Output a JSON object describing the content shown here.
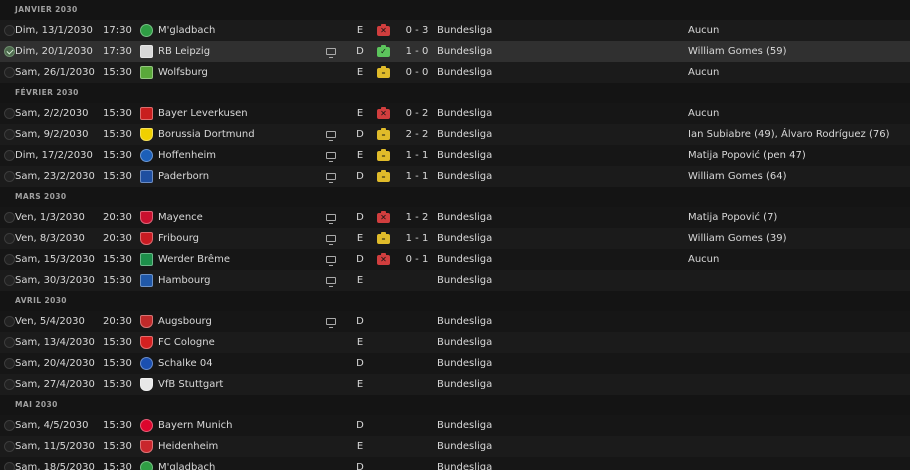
{
  "months": [
    {
      "label": "JANVIER 2030",
      "matches": [
        {
          "date": "Dim, 13/1/2030",
          "time": "17:30",
          "team": "M'gladbach",
          "crest": "mgladbach",
          "tv": false,
          "venue": "E",
          "result": "loss",
          "result_icon": "✕",
          "score": "0 - 3",
          "competition": "Bundesliga",
          "scorers": "Aucun",
          "selected": false
        },
        {
          "date": "Dim, 20/1/2030",
          "time": "17:30",
          "team": "RB Leipzig",
          "crest": "leipzig",
          "tv": true,
          "venue": "D",
          "result": "win",
          "result_icon": "✓",
          "score": "1 - 0",
          "competition": "Bundesliga",
          "scorers": "William Gomes (59)",
          "selected": true
        },
        {
          "date": "Sam, 26/1/2030",
          "time": "15:30",
          "team": "Wolfsburg",
          "crest": "wolfsburg",
          "tv": false,
          "venue": "E",
          "result": "draw",
          "result_icon": "–",
          "score": "0 - 0",
          "competition": "Bundesliga",
          "scorers": "Aucun",
          "selected": false
        }
      ]
    },
    {
      "label": "FÉVRIER 2030",
      "matches": [
        {
          "date": "Sam, 2/2/2030",
          "time": "15:30",
          "team": "Bayer Leverkusen",
          "crest": "leverkusen",
          "tv": false,
          "venue": "E",
          "result": "loss",
          "result_icon": "✕",
          "score": "0 - 2",
          "competition": "Bundesliga",
          "scorers": "Aucun",
          "selected": false
        },
        {
          "date": "Sam, 9/2/2030",
          "time": "15:30",
          "team": "Borussia Dortmund",
          "crest": "dortmund",
          "tv": true,
          "venue": "D",
          "result": "draw",
          "result_icon": "–",
          "score": "2 - 2",
          "competition": "Bundesliga",
          "scorers": "Ian Subiabre (49), Álvaro Rodríguez (76)",
          "selected": false
        },
        {
          "date": "Dim, 17/2/2030",
          "time": "15:30",
          "team": "Hoffenheim",
          "crest": "hoffenheim",
          "tv": true,
          "venue": "E",
          "result": "draw",
          "result_icon": "–",
          "score": "1 - 1",
          "competition": "Bundesliga",
          "scorers": "Matija Popović (pen 47)",
          "selected": false
        },
        {
          "date": "Sam, 23/2/2030",
          "time": "15:30",
          "team": "Paderborn",
          "crest": "paderborn",
          "tv": true,
          "venue": "D",
          "result": "draw",
          "result_icon": "–",
          "score": "1 - 1",
          "competition": "Bundesliga",
          "scorers": "William Gomes (64)",
          "selected": false
        }
      ]
    },
    {
      "label": "MARS 2030",
      "matches": [
        {
          "date": "Ven, 1/3/2030",
          "time": "20:30",
          "team": "Mayence",
          "crest": "mainz",
          "tv": true,
          "venue": "D",
          "result": "loss",
          "result_icon": "✕",
          "score": "1 - 2",
          "competition": "Bundesliga",
          "scorers": "Matija Popović (7)",
          "selected": false
        },
        {
          "date": "Ven, 8/3/2030",
          "time": "20:30",
          "team": "Fribourg",
          "crest": "freiburg",
          "tv": true,
          "venue": "E",
          "result": "draw",
          "result_icon": "–",
          "score": "1 - 1",
          "competition": "Bundesliga",
          "scorers": "William Gomes (39)",
          "selected": false
        },
        {
          "date": "Sam, 15/3/2030",
          "time": "15:30",
          "team": "Werder Brême",
          "crest": "bremen",
          "tv": true,
          "venue": "D",
          "result": "loss",
          "result_icon": "✕",
          "score": "0 - 1",
          "competition": "Bundesliga",
          "scorers": "Aucun",
          "selected": false
        },
        {
          "date": "Sam, 30/3/2030",
          "time": "15:30",
          "team": "Hambourg",
          "crest": "hamburg",
          "tv": true,
          "venue": "E",
          "result": "",
          "result_icon": "",
          "score": "",
          "competition": "Bundesliga",
          "scorers": "",
          "selected": false
        }
      ]
    },
    {
      "label": "AVRIL 2030",
      "matches": [
        {
          "date": "Ven, 5/4/2030",
          "time": "20:30",
          "team": "Augsbourg",
          "crest": "augsburg",
          "tv": true,
          "venue": "D",
          "result": "",
          "result_icon": "",
          "score": "",
          "competition": "Bundesliga",
          "scorers": "",
          "selected": false
        },
        {
          "date": "Sam, 13/4/2030",
          "time": "15:30",
          "team": "FC Cologne",
          "crest": "koln",
          "tv": false,
          "venue": "E",
          "result": "",
          "result_icon": "",
          "score": "",
          "competition": "Bundesliga",
          "scorers": "",
          "selected": false
        },
        {
          "date": "Sam, 20/4/2030",
          "time": "15:30",
          "team": "Schalke 04",
          "crest": "schalke",
          "tv": false,
          "venue": "D",
          "result": "",
          "result_icon": "",
          "score": "",
          "competition": "Bundesliga",
          "scorers": "",
          "selected": false
        },
        {
          "date": "Sam, 27/4/2030",
          "time": "15:30",
          "team": "VfB Stuttgart",
          "crest": "stuttgart",
          "tv": false,
          "venue": "E",
          "result": "",
          "result_icon": "",
          "score": "",
          "competition": "Bundesliga",
          "scorers": "",
          "selected": false
        }
      ]
    },
    {
      "label": "MAI 2030",
      "matches": [
        {
          "date": "Sam, 4/5/2030",
          "time": "15:30",
          "team": "Bayern Munich",
          "crest": "bayern",
          "tv": false,
          "venue": "D",
          "result": "",
          "result_icon": "",
          "score": "",
          "competition": "Bundesliga",
          "scorers": "",
          "selected": false
        },
        {
          "date": "Sam, 11/5/2030",
          "time": "15:30",
          "team": "Heidenheim",
          "crest": "heidenheim",
          "tv": false,
          "venue": "E",
          "result": "",
          "result_icon": "",
          "score": "",
          "competition": "Bundesliga",
          "scorers": "",
          "selected": false
        },
        {
          "date": "Sam, 18/5/2030",
          "time": "15:30",
          "team": "M'gladbach",
          "crest": "mgladbach",
          "tv": false,
          "venue": "D",
          "result": "",
          "result_icon": "",
          "score": "",
          "competition": "Bundesliga",
          "scorers": "",
          "selected": false
        }
      ]
    }
  ],
  "crest_colors": {
    "mgladbach": "#2f9e44",
    "leipzig": "#d9d9d9",
    "wolfsburg": "#5aa83a",
    "leverkusen": "#c81e1e",
    "dortmund": "#f0d000",
    "hoffenheim": "#1c5fb8",
    "paderborn": "#1f4fa0",
    "mainz": "#c8102e",
    "freiburg": "#c91b22",
    "bremen": "#1d8f4a",
    "hamburg": "#2058a8",
    "augsburg": "#bf2a2a",
    "koln": "#d42020",
    "schalke": "#1a4fb0",
    "stuttgart": "#e8e8e8",
    "bayern": "#dc052d",
    "heidenheim": "#c9262c"
  }
}
